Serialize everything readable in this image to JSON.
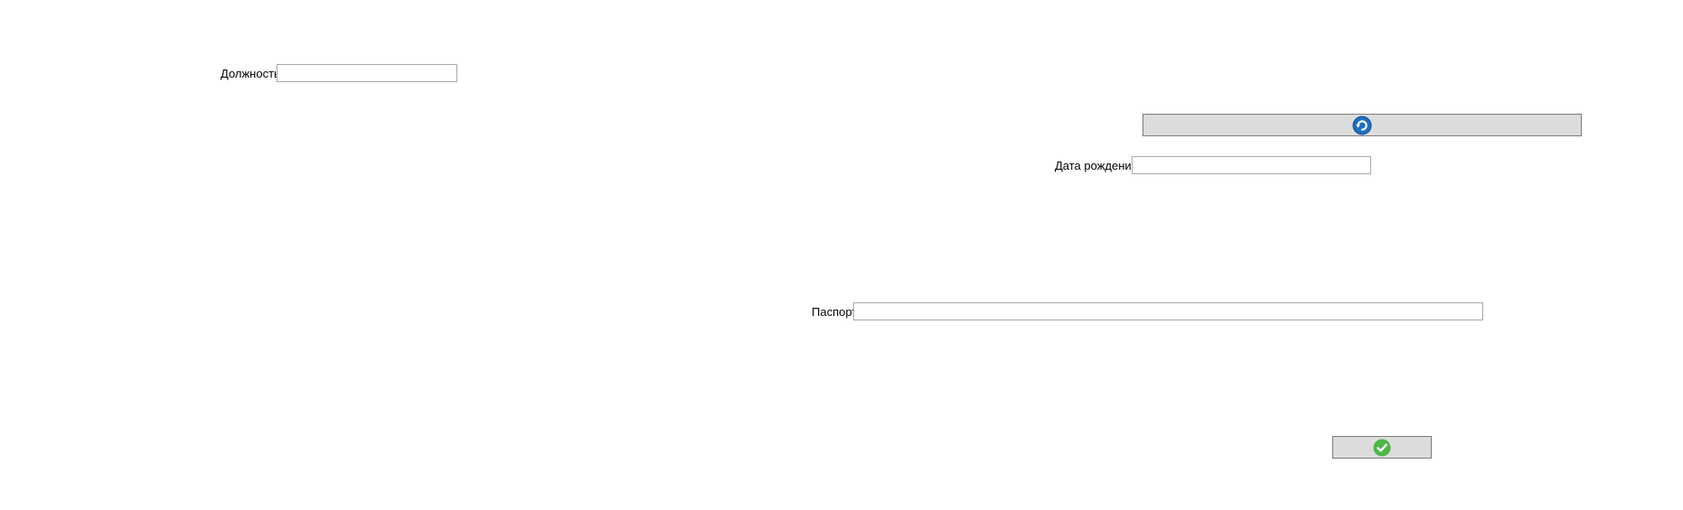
{
  "form": {
    "position_label": "Должность",
    "position_value": "",
    "birthdate_label": "Дата рождения",
    "birthdate_value": "",
    "passport_label": "Паспорт",
    "passport_value": ""
  },
  "buttons": {
    "refresh_icon": "refresh-icon",
    "confirm_icon": "checkmark-icon"
  },
  "colors": {
    "button_bg": "#dcdcdc",
    "refresh_blue": "#1e6fc0",
    "confirm_green": "#4cb648"
  }
}
